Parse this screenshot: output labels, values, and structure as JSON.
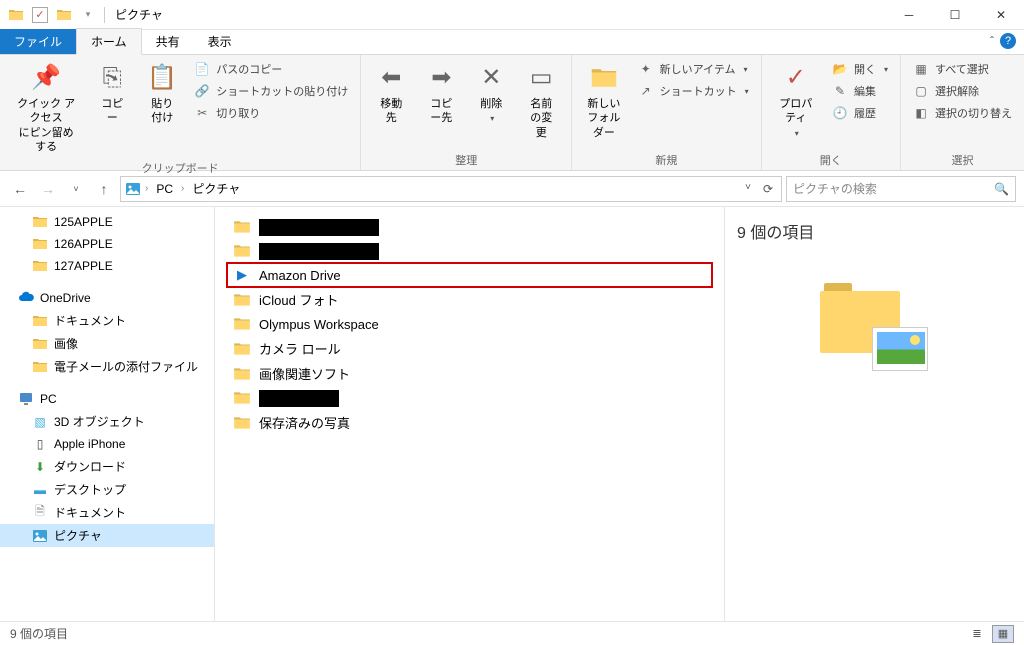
{
  "title": "ピクチャ",
  "tabs": {
    "file": "ファイル",
    "home": "ホーム",
    "share": "共有",
    "view": "表示"
  },
  "ribbon": {
    "clipboard": {
      "label": "クリップボード",
      "pin": "クイック アクセス\nにピン留めする",
      "copy": "コピー",
      "paste": "貼り付け",
      "copy_path": "パスのコピー",
      "paste_shortcut": "ショートカットの貼り付け",
      "cut": "切り取り"
    },
    "organize": {
      "label": "整理",
      "move_to": "移動先",
      "copy_to": "コピー先",
      "delete": "削除",
      "rename": "名前\nの変更"
    },
    "new": {
      "label": "新規",
      "new_folder": "新しい\nフォルダー",
      "new_item": "新しいアイテム",
      "shortcut": "ショートカット"
    },
    "open": {
      "label": "開く",
      "properties": "プロパティ",
      "open": "開く",
      "edit": "編集",
      "history": "履歴"
    },
    "select": {
      "label": "選択",
      "select_all": "すべて選択",
      "select_none": "選択解除",
      "invert": "選択の切り替え"
    }
  },
  "breadcrumb": {
    "pc": "PC",
    "pictures": "ピクチャ"
  },
  "search_placeholder": "ピクチャの検索",
  "tree": {
    "apple125": "125APPLE",
    "apple126": "126APPLE",
    "apple127": "127APPLE",
    "onedrive": "OneDrive",
    "documents_od": "ドキュメント",
    "images_od": "画像",
    "email_attach": "電子メールの添付ファイル",
    "pc": "PC",
    "objects3d": "3D オブジェクト",
    "iphone": "Apple iPhone",
    "downloads": "ダウンロード",
    "desktop": "デスクトップ",
    "documents": "ドキュメント",
    "pictures": "ピクチャ"
  },
  "files": {
    "amazon": "Amazon Drive",
    "icloud": "iCloud フォト",
    "olympus": "Olympus Workspace",
    "camera": "カメラ ロール",
    "soft": "画像関連ソフト",
    "saved": "保存済みの写真"
  },
  "preview": {
    "title": "9 個の項目"
  },
  "status": {
    "count": "9 個の項目"
  }
}
